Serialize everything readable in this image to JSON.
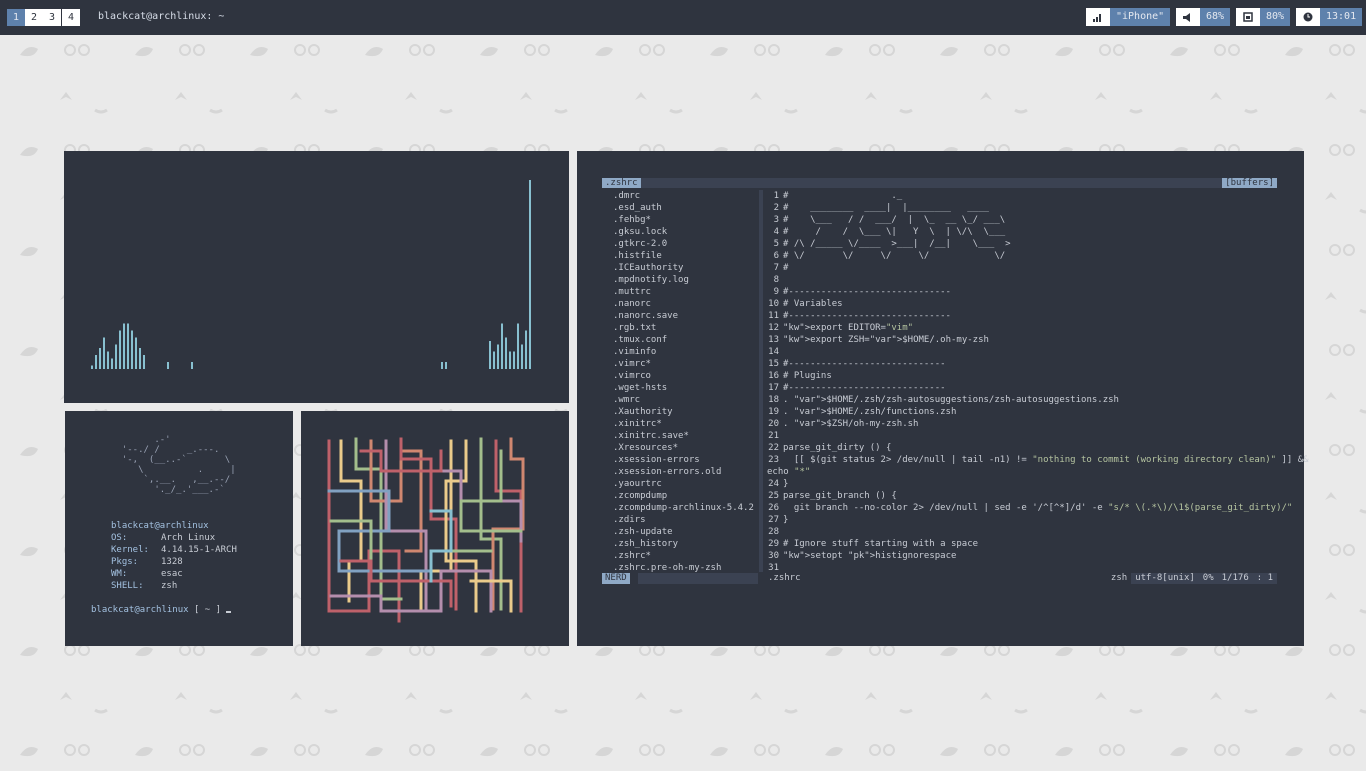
{
  "topbar": {
    "workspaces": [
      "1",
      "2",
      "3",
      "4"
    ],
    "active_workspace": "1",
    "window_title": "blackcat@archlinux: ~",
    "wifi": {
      "icon": "signal-bars-icon",
      "value": "\"iPhone\""
    },
    "volume": {
      "icon": "speaker-icon",
      "value": "68%"
    },
    "battery": {
      "icon": "battery-icon",
      "value": "80%"
    },
    "clock": {
      "icon": "clock-icon",
      "value": "13:01"
    },
    "accent": "#5e81ac"
  },
  "fetch": {
    "ascii": "        .-'\n  '--./ /     _.---.\n  '-,  (__..-`       \\\n     \\          .     |\n      `,.__.   ,__.--/\n        '._/_.'___.-`",
    "user_host": "blackcat@archlinux",
    "rows": [
      {
        "key": "OS:",
        "value": "Arch Linux"
      },
      {
        "key": "Kernel:",
        "value": "4.14.15-1-ARCH"
      },
      {
        "key": "Pkgs:",
        "value": "1328"
      },
      {
        "key": "WM:",
        "value": "esac"
      },
      {
        "key": "SHELL:",
        "value": "zsh"
      }
    ],
    "prompt_user": "blackcat@archlinux",
    "prompt_rest": " [ ~ ] "
  },
  "vim": {
    "tab_label": ".zshrc",
    "buffers_label": "[buffers]",
    "nerdtree_files": [
      ".dmrc",
      ".esd_auth",
      ".fehbg*",
      ".gksu.lock",
      ".gtkrc-2.0",
      ".histfile",
      ".ICEauthority",
      ".mpdnotify.log",
      ".muttrc",
      ".nanorc",
      ".nanorc.save",
      ".rgb.txt",
      ".tmux.conf",
      ".viminfo",
      ".vimrc*",
      ".vimrco",
      ".wget-hsts",
      ".wmrc",
      ".Xauthority",
      ".xinitrc*",
      ".xinitrc.save*",
      ".Xresources*",
      ".xsession-errors",
      ".xsession-errors.old",
      ".yaourtrc",
      ".zcompdump",
      ".zcompdump-archlinux-5.4.2",
      ".zdirs",
      ".zsh-update",
      ".zsh_history",
      ".zshrc*",
      ".zshrc.pre-oh-my-zsh"
    ],
    "code_lines": [
      {
        "n": "1",
        "t": "#                   ._"
      },
      {
        "n": "2",
        "t": "#    ________  ____|  |________   ____"
      },
      {
        "n": "3",
        "t": "#    \\___   / /  ___/  |  \\_  __ \\_/ ___\\"
      },
      {
        "n": "4",
        "t": "#     /    /  \\___ \\|   Y  \\  | \\/\\  \\___"
      },
      {
        "n": "5",
        "t": "# /\\ /_____ \\/____  >___|  /__|    \\___  >"
      },
      {
        "n": "6",
        "t": "# \\/       \\/     \\/     \\/            \\/"
      },
      {
        "n": "7",
        "t": "#"
      },
      {
        "n": "8",
        "t": ""
      },
      {
        "n": "9",
        "t": "#------------------------------"
      },
      {
        "n": "10",
        "t": "# Variables"
      },
      {
        "n": "11",
        "t": "#------------------------------"
      },
      {
        "n": "12",
        "t": "export EDITOR=\"vim\""
      },
      {
        "n": "13",
        "t": "export ZSH=$HOME/.oh-my-zsh"
      },
      {
        "n": "14",
        "t": ""
      },
      {
        "n": "15",
        "t": "#-----------------------------"
      },
      {
        "n": "16",
        "t": "# Plugins"
      },
      {
        "n": "17",
        "t": "#-----------------------------"
      },
      {
        "n": "18",
        "t": ". $HOME/.zsh/zsh-autosuggestions/zsh-autosuggestions.zsh"
      },
      {
        "n": "19",
        "t": ". $HOME/.zsh/functions.zsh"
      },
      {
        "n": "20",
        "t": ". $ZSH/oh-my-zsh.sh"
      },
      {
        "n": "21",
        "t": ""
      },
      {
        "n": "22",
        "t": "parse_git_dirty () {"
      },
      {
        "n": "23",
        "t": "  [[ $(git status 2> /dev/null | tail -n1) != \"nothing to commit (working directory clean)\" ]] &&"
      },
      {
        "n": "",
        "t": "echo \"*\""
      },
      {
        "n": "24",
        "t": "}"
      },
      {
        "n": "25",
        "t": "parse_git_branch () {"
      },
      {
        "n": "26",
        "t": "  git branch --no-color 2> /dev/null | sed -e '/^[^*]/d' -e \"s/* \\(.*\\)/\\1$(parse_git_dirty)/\""
      },
      {
        "n": "27",
        "t": "}"
      },
      {
        "n": "28",
        "t": ""
      },
      {
        "n": "29",
        "t": "# Ignore stuff starting with a space"
      },
      {
        "n": "30",
        "t": "setopt histignorespace"
      },
      {
        "n": "31",
        "t": ""
      }
    ],
    "status": {
      "mode": "NERD",
      "filename": ".zshrc",
      "filetype": "zsh",
      "encoding": "utf-8[unix]",
      "percent": "0% ",
      "position": "1/176 ",
      "column": ":  1"
    }
  },
  "visualizer": {
    "bar_color": "#88c0d0",
    "bars": [
      0.1,
      0.3,
      0.45,
      0.7,
      0.5,
      0.3,
      0.2,
      0.35,
      0.6,
      0.8,
      0.8,
      0.7,
      0.5,
      0.35,
      0.2,
      0,
      0,
      0,
      0,
      0,
      0,
      0.1,
      0,
      0,
      0,
      0,
      0,
      0.1
    ]
  }
}
